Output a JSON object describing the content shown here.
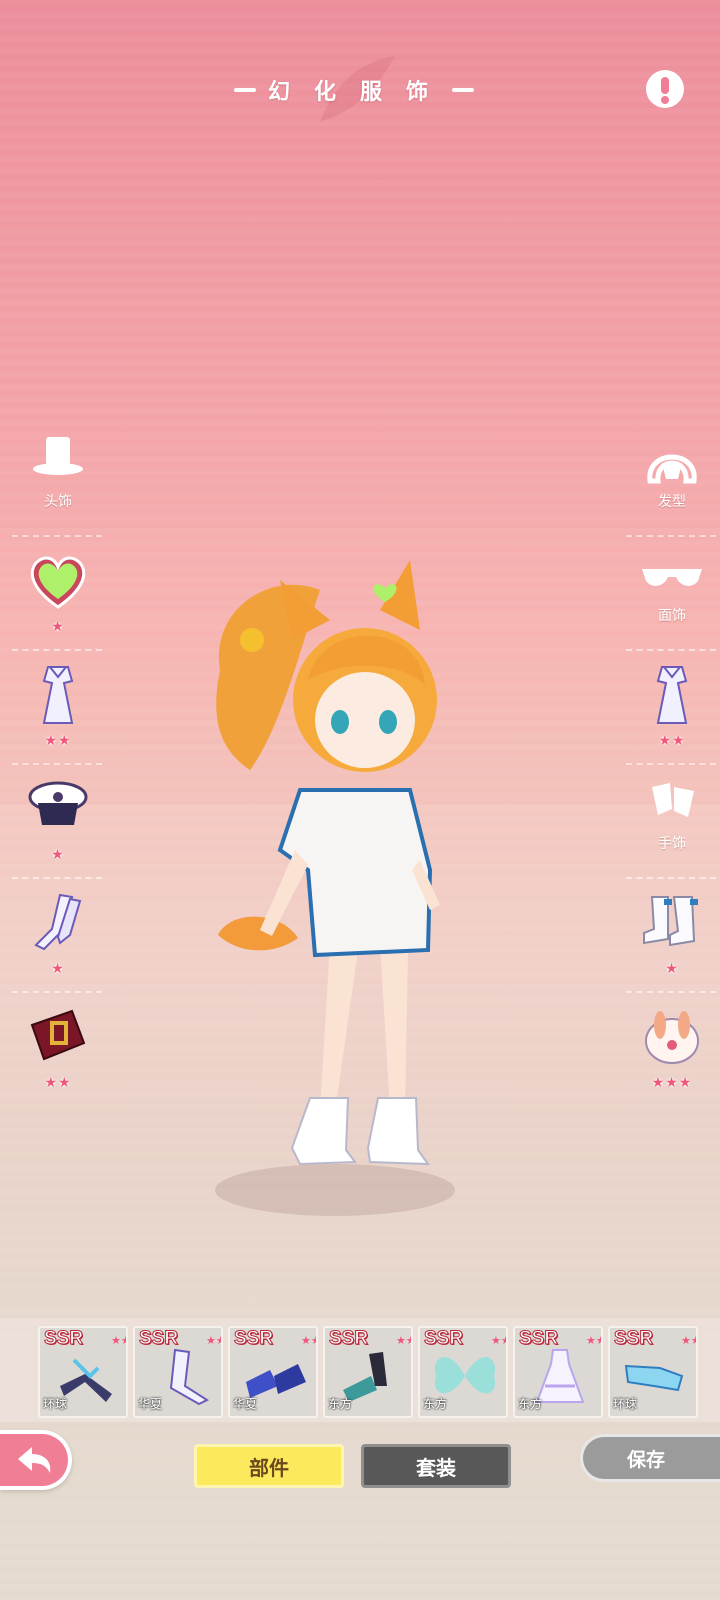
{
  "header": {
    "title": "幻化服饰",
    "info_icon": "exclamation-icon"
  },
  "left_slots": [
    {
      "label": "头饰",
      "icon": "top-hat-icon",
      "stars": ""
    },
    {
      "label": "",
      "icon": "heart-badge-icon",
      "stars": "★"
    },
    {
      "label": "",
      "icon": "dress-icon",
      "stars": "★★"
    },
    {
      "label": "",
      "icon": "captain-hat-icon",
      "stars": "★"
    },
    {
      "label": "",
      "icon": "stockings-icon",
      "stars": "★"
    },
    {
      "label": "",
      "icon": "belt-icon",
      "stars": "★★"
    }
  ],
  "right_slots": [
    {
      "label": "发型",
      "icon": "hairstyle-icon",
      "stars": ""
    },
    {
      "label": "面饰",
      "icon": "glasses-icon",
      "stars": ""
    },
    {
      "label": "",
      "icon": "dress-icon",
      "stars": "★★"
    },
    {
      "label": "手饰",
      "icon": "gloves-icon",
      "stars": ""
    },
    {
      "label": "",
      "icon": "boots-icon",
      "stars": "★"
    },
    {
      "label": "",
      "icon": "bunny-backpack-icon",
      "stars": "★★★"
    }
  ],
  "items": [
    {
      "rank": "SSR",
      "category": "环球",
      "stars": "★★★★",
      "icon": "ribbon-bow-icon",
      "color": "#3b3b6b"
    },
    {
      "rank": "SSR",
      "category": "华夏",
      "stars": "★★★★",
      "icon": "stockings-icon",
      "color": "#f2f2ff"
    },
    {
      "rank": "SSR",
      "category": "华夏",
      "stars": "★★★★",
      "icon": "shoes-icon",
      "color": "#3f4fc8"
    },
    {
      "rank": "SSR",
      "category": "东方",
      "stars": "★★★★",
      "icon": "heels-icon",
      "color": "#3c9a9a"
    },
    {
      "rank": "SSR",
      "category": "东方",
      "stars": "★★★★",
      "icon": "wings-icon",
      "color": "#8fe0dc"
    },
    {
      "rank": "SSR",
      "category": "东方",
      "stars": "★★★★",
      "icon": "dress-icon",
      "color": "#b9a6ee"
    },
    {
      "rank": "SSR",
      "category": "环球",
      "stars": "★★★★",
      "icon": "sleeve-icon",
      "color": "#8dd6f2"
    }
  ],
  "tabs": {
    "parts": "部件",
    "set": "套装"
  },
  "buttons": {
    "save": "保存",
    "back_icon": "back-arrow-icon"
  }
}
